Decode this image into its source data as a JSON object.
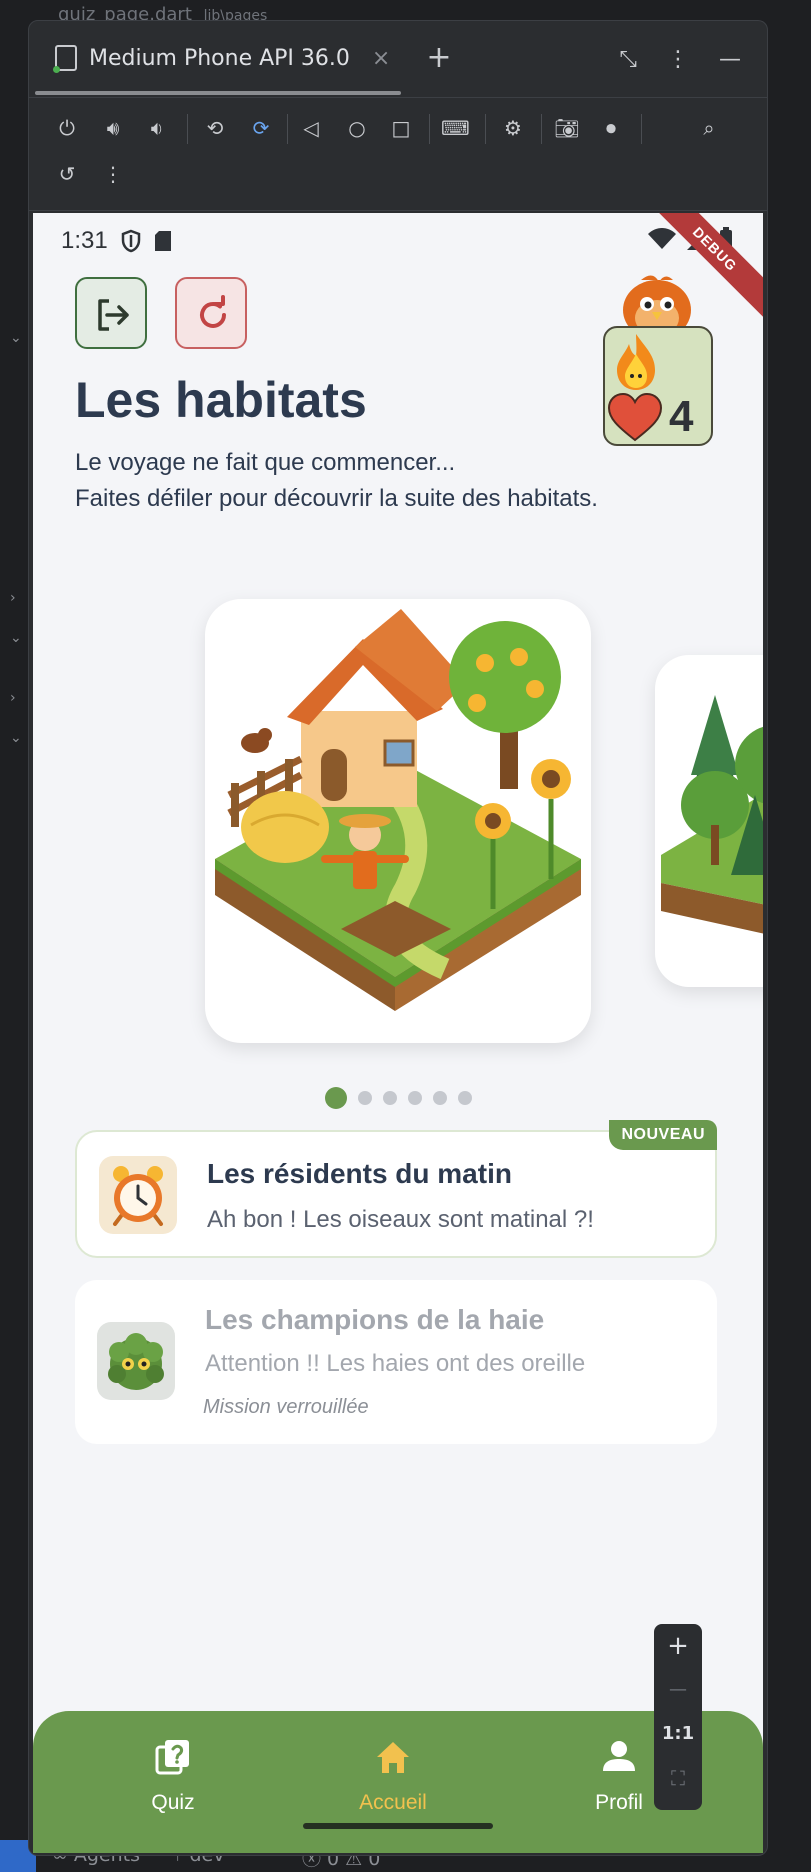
{
  "ide": {
    "top_tab": "quiz_page.dart",
    "top_path": "lib\\pages",
    "bottom": {
      "agents": "Agents",
      "branch": "dev*",
      "errors": "0",
      "warnings": "0"
    }
  },
  "emulator": {
    "tab_title": "Medium Phone API 36.0",
    "close_glyph": "×",
    "add_glyph": "+",
    "zoom": {
      "plus": "+",
      "minus": "—",
      "ratio": "1:1"
    }
  },
  "phone": {
    "status": {
      "time": "1:31"
    },
    "debug_label": "DEBUG",
    "header": {
      "title": "Les habitats",
      "subtitle_line1": "Le voyage ne fait que commencer...",
      "subtitle_line2": "Faites défiler pour découvrir la suite des habitats."
    },
    "stats": {
      "count": "4"
    },
    "carousel": {
      "page_count": 6,
      "active_index": 0
    },
    "missions": [
      {
        "title": "Les résidents du matin",
        "description": "Ah bon ! Les oiseaux sont matinal ?!",
        "badge": "NOUVEAU",
        "locked": false
      },
      {
        "title": "Les champions de la haie",
        "description": "Attention !! Les haies ont des oreille",
        "lock_text": "Mission verrouillée",
        "locked": true
      }
    ],
    "nav": [
      {
        "label": "Quiz",
        "icon": "quiz-icon",
        "active": false
      },
      {
        "label": "Accueil",
        "icon": "home-icon",
        "active": true
      },
      {
        "label": "Profil",
        "icon": "person-icon",
        "active": false
      }
    ]
  },
  "colors": {
    "accent_green": "#6a994e",
    "nav_active": "#f2c14e",
    "title": "#2d3a4f"
  }
}
